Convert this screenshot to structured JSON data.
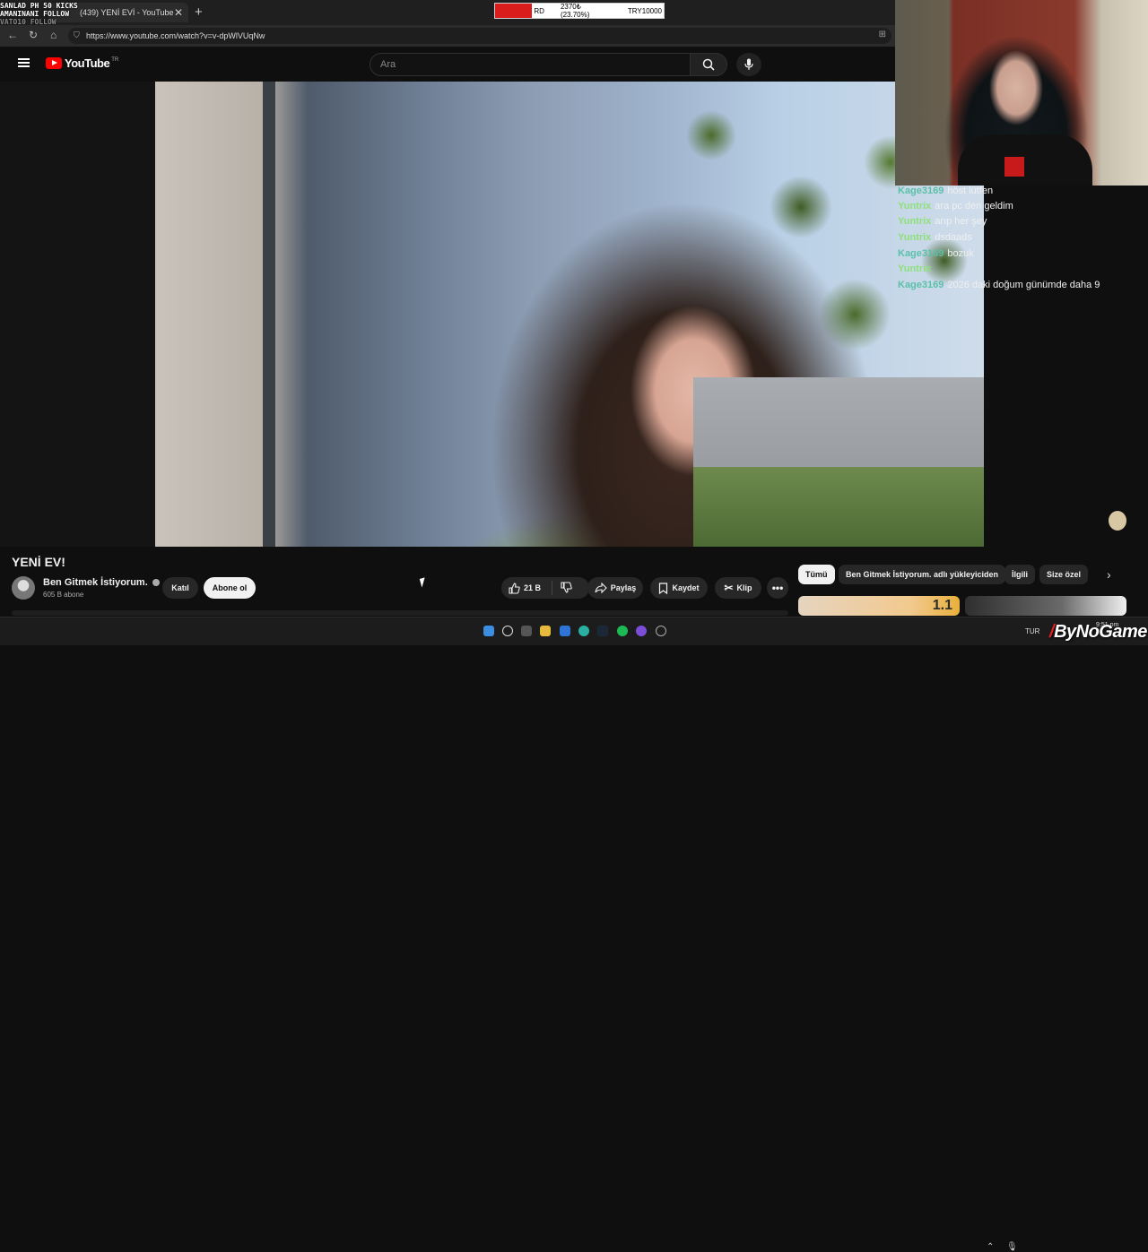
{
  "overlay": {
    "line1": "SANLAD PH 50 KICKS",
    "line2": "AMANINANI FOLLOW",
    "line3": "VATO10 FOLLOW"
  },
  "browser": {
    "tab_title": "(439) YENİ EVİ - YouTube",
    "url": "https://www.youtube.com/watch?v=v-dpWlVUqNw"
  },
  "donation_bar": {
    "label": "RD",
    "progress_text": "2370₺ (23.70%)",
    "goal": "TRY10000",
    "progress": 0.237
  },
  "youtube": {
    "logo_text": "YouTube",
    "region": "TR",
    "search_placeholder": "Ara"
  },
  "video": {
    "title": "YENİ EV!",
    "channel_name": "Ben Gitmek İstiyorum.",
    "subscribers": "605 B abone",
    "join_label": "Katıl",
    "subscribe_label": "Abone ol",
    "likes": "21 B",
    "share_label": "Paylaş",
    "save_label": "Kaydet",
    "clip_label": "Klip"
  },
  "chips": [
    {
      "label": "Tümü",
      "active": true
    },
    {
      "label": "Ben Gitmek İstiyorum. adlı yükleyiciden",
      "active": false
    },
    {
      "label": "İlgili",
      "active": false
    },
    {
      "label": "Size özel",
      "active": false
    }
  ],
  "thumb1_text": "1.1",
  "chat": [
    {
      "user": "Kage3169",
      "color": "#5bc0a8",
      "msg": "höst lütfen"
    },
    {
      "user": "Yuntrix",
      "color": "#8fe07a",
      "msg": "ara pc den geldim"
    },
    {
      "user": "Yuntrix",
      "color": "#8fe07a",
      "msg": "arıp her şey"
    },
    {
      "user": "Yuntrix",
      "color": "#8fe07a",
      "msg": "dsdaads"
    },
    {
      "user": "Kage3169",
      "color": "#5bc0a8",
      "msg": "bozuk"
    },
    {
      "user": "Yuntrix",
      "color": "#8fe07a",
      "msg": ""
    },
    {
      "user": "Kage3169",
      "color": "#5bc0a8",
      "msg": "2026 daki doğum günümde daha 9"
    }
  ],
  "taskbar": {
    "tray_text": "TUR",
    "clock": "9:51 pm",
    "brand": "ByNoGame"
  }
}
